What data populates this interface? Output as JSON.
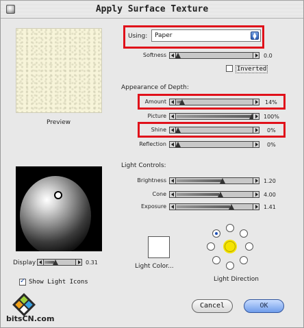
{
  "window": {
    "title": "Apply Surface Texture"
  },
  "preview": {
    "caption": "Preview",
    "texture_color": "#f7f4d9"
  },
  "using": {
    "label": "Using:",
    "value": "Paper"
  },
  "softness": {
    "label": "Softness",
    "value": "0.0",
    "level": 0.0
  },
  "inverted": {
    "label": "Inverted",
    "checked": false
  },
  "depth": {
    "heading": "Appearance of Depth:",
    "rows": [
      {
        "label": "Amount",
        "value": "14%",
        "level": 0.14
      },
      {
        "label": "Picture",
        "value": "100%",
        "level": 1.0
      },
      {
        "label": "Shine",
        "value": "0%",
        "level": 0.0
      },
      {
        "label": "Reflection",
        "value": "0%",
        "level": 0.0
      }
    ]
  },
  "light": {
    "heading": "Light Controls:",
    "rows": [
      {
        "label": "Brightness",
        "value": "1.20",
        "level": 0.6
      },
      {
        "label": "Cone",
        "value": "4.00",
        "level": 0.58
      },
      {
        "label": "Exposure",
        "value": "1.41",
        "level": 0.71
      }
    ],
    "color_caption": "Light Color...",
    "direction_caption": "Light Direction"
  },
  "display": {
    "label": "Display",
    "value": "0.31",
    "level": 0.31
  },
  "show_icons": {
    "label": "Show Light Icons",
    "checked": true
  },
  "buttons": {
    "cancel": "Cancel",
    "ok": "OK"
  },
  "watermark": {
    "text": "bitsCN.com"
  },
  "colors": {
    "highlight": "#e0101a",
    "accent": "#2c5fb8",
    "sun": "#f5e400"
  }
}
